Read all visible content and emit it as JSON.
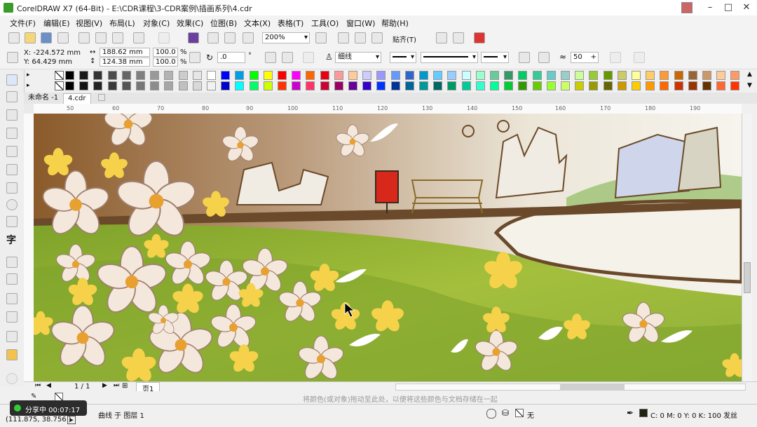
{
  "window": {
    "title": "CorelDRAW X7 (64-Bit) - E:\\CDR课程\\3-CDR案例\\插画系列\\4.cdr",
    "min": "–",
    "max": "□",
    "close": "✕"
  },
  "menu": [
    "文件(F)",
    "编辑(E)",
    "视图(V)",
    "布局(L)",
    "对象(C)",
    "效果(C)",
    "位图(B)",
    "文本(X)",
    "表格(T)",
    "工具(O)",
    "窗口(W)",
    "帮助(H)"
  ],
  "toolbar": {
    "zoom": "200%",
    "snap": "贴齐(T)"
  },
  "props": {
    "x": "X: -224.572 mm",
    "y": "Y: 64.429 mm",
    "w": "188.62 mm",
    "h": "124.38 mm",
    "sx": "100.0",
    "sy": "100.0",
    "pct": "%",
    "angle": ".0",
    "deg": "°",
    "outline": "细线",
    "smooth": "50"
  },
  "palette": {
    "row1": [
      "#000000",
      "#1a1a1a",
      "#333333",
      "#4d4d4d",
      "#666666",
      "#808080",
      "#999999",
      "#b3b3b3",
      "#cccccc",
      "#e6e6e6",
      "#ffffff",
      "#0000ff",
      "#00a0e9",
      "#00ff00",
      "#ffff00",
      "#ff0000",
      "#ff00ff",
      "#ff6600",
      "#e60012",
      "#ff9999",
      "#ffcc99",
      "#ccccff",
      "#9999ff",
      "#6699ff",
      "#3366cc",
      "#0099cc",
      "#66ccff",
      "#99ccff",
      "#ccffff",
      "#99ffcc",
      "#66cc99",
      "#339966",
      "#00cc66",
      "#33cc99",
      "#66cccc",
      "#99cccc",
      "#ccff99",
      "#99cc33",
      "#669900",
      "#cccc66",
      "#ffff99",
      "#ffcc66",
      "#ff9933",
      "#cc6600",
      "#996633",
      "#cc9966",
      "#ffcc99",
      "#ff9966"
    ],
    "row2": [
      "#000000",
      "#111111",
      "#222222",
      "#3a3a3a",
      "#555555",
      "#777777",
      "#8c8c8c",
      "#a6a6a6",
      "#c0c0c0",
      "#d9d9d9",
      "#f2f2f2",
      "#0000cc",
      "#00ffff",
      "#00ff66",
      "#ccff00",
      "#ff3300",
      "#cc00cc",
      "#ff3366",
      "#cc0033",
      "#990066",
      "#660099",
      "#3300cc",
      "#0033ff",
      "#003399",
      "#006699",
      "#009999",
      "#006666",
      "#009966",
      "#00cc99",
      "#33ffcc",
      "#00ff99",
      "#00cc33",
      "#339900",
      "#66cc00",
      "#99ff33",
      "#ccff66",
      "#cccc00",
      "#999900",
      "#666600",
      "#cc9900",
      "#ffcc00",
      "#ff9900",
      "#ff6600",
      "#cc3300",
      "#993300",
      "#663300",
      "#ff6633",
      "#ff3300"
    ]
  },
  "tabs": {
    "t1": "未命名 -1",
    "t2": "4.cdr"
  },
  "ruler": [
    "50",
    "60",
    "70",
    "80",
    "90",
    "100",
    "110",
    "120",
    "130",
    "140",
    "150",
    "160",
    "170",
    "180",
    "190"
  ],
  "page": {
    "count": "1 / 1",
    "name": "页1"
  },
  "hint": "将颜色(或对象)拖动至此处，以便将这些颜色与文档存储在一起",
  "status": {
    "coords": "(111.875, 38.756 )",
    "layer": "曲线 于 图层 1",
    "fill": "无",
    "outline": "C: 0 M: 0 Y: 0 K: 100 发丝",
    "share": "分享中 00:07:17"
  }
}
